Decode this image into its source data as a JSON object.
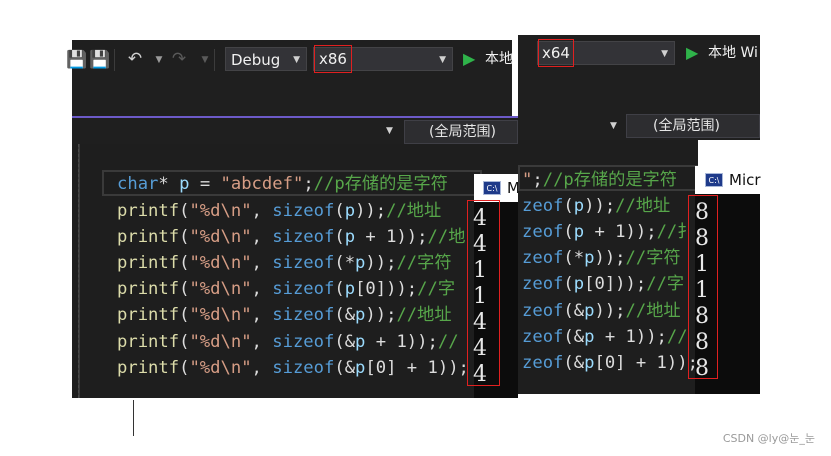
{
  "left_window": {
    "toolbar": {
      "undo_icon": "undo-icon",
      "redo_icon": "redo-icon",
      "save_icon": "save-icon",
      "save_all_icon": "save-all-icon",
      "configuration": "Debug",
      "platform": "x86",
      "run_label": "本地"
    },
    "scope_combo": "(全局范围)",
    "code_lines": [
      {
        "parts": [
          [
            "kw",
            "char"
          ],
          [
            "plain",
            "* "
          ],
          [
            "var",
            "p"
          ],
          [
            "plain",
            " = "
          ],
          [
            "str",
            "\"abcdef\""
          ],
          [
            "plain",
            ";"
          ],
          [
            "cmt",
            "//p存储的是字符"
          ]
        ]
      },
      {
        "parts": [
          [
            "fn",
            "printf"
          ],
          [
            "plain",
            "("
          ],
          [
            "str",
            "\"%d\\n\""
          ],
          [
            "plain",
            ", "
          ],
          [
            "kw",
            "sizeof"
          ],
          [
            "plain",
            "("
          ],
          [
            "var",
            "p"
          ],
          [
            "plain",
            "));"
          ],
          [
            "cmt",
            "//地址"
          ]
        ]
      },
      {
        "parts": [
          [
            "fn",
            "printf"
          ],
          [
            "plain",
            "("
          ],
          [
            "str",
            "\"%d\\n\""
          ],
          [
            "plain",
            ", "
          ],
          [
            "kw",
            "sizeof"
          ],
          [
            "plain",
            "("
          ],
          [
            "var",
            "p"
          ],
          [
            "plain",
            " + 1));"
          ],
          [
            "cmt",
            "//地"
          ]
        ]
      },
      {
        "parts": [
          [
            "fn",
            "printf"
          ],
          [
            "plain",
            "("
          ],
          [
            "str",
            "\"%d\\n\""
          ],
          [
            "plain",
            ", "
          ],
          [
            "kw",
            "sizeof"
          ],
          [
            "plain",
            "(*"
          ],
          [
            "var",
            "p"
          ],
          [
            "plain",
            "));"
          ],
          [
            "cmt",
            "//字符"
          ]
        ]
      },
      {
        "parts": [
          [
            "fn",
            "printf"
          ],
          [
            "plain",
            "("
          ],
          [
            "str",
            "\"%d\\n\""
          ],
          [
            "plain",
            ", "
          ],
          [
            "kw",
            "sizeof"
          ],
          [
            "plain",
            "("
          ],
          [
            "var",
            "p"
          ],
          [
            "plain",
            "[0]));"
          ],
          [
            "cmt",
            "//字"
          ]
        ]
      },
      {
        "parts": [
          [
            "fn",
            "printf"
          ],
          [
            "plain",
            "("
          ],
          [
            "str",
            "\"%d\\n\""
          ],
          [
            "plain",
            ", "
          ],
          [
            "kw",
            "sizeof"
          ],
          [
            "plain",
            "(&"
          ],
          [
            "var",
            "p"
          ],
          [
            "plain",
            "));"
          ],
          [
            "cmt",
            "//地址"
          ]
        ]
      },
      {
        "parts": [
          [
            "fn",
            "printf"
          ],
          [
            "plain",
            "("
          ],
          [
            "str",
            "\"%d\\n\""
          ],
          [
            "plain",
            ", "
          ],
          [
            "kw",
            "sizeof"
          ],
          [
            "plain",
            "(&"
          ],
          [
            "var",
            "p"
          ],
          [
            "plain",
            " + 1));"
          ],
          [
            "cmt",
            "//"
          ]
        ]
      },
      {
        "parts": [
          [
            "fn",
            "printf"
          ],
          [
            "plain",
            "("
          ],
          [
            "str",
            "\"%d\\n\""
          ],
          [
            "plain",
            ", "
          ],
          [
            "kw",
            "sizeof"
          ],
          [
            "plain",
            "(&"
          ],
          [
            "var",
            "p"
          ],
          [
            "plain",
            "[0] + 1));"
          ]
        ]
      }
    ],
    "console": {
      "title": "Mic",
      "icon": "C:\\",
      "outputs": [
        "4",
        "4",
        "1",
        "1",
        "4",
        "4",
        "4"
      ]
    }
  },
  "right_window": {
    "toolbar": {
      "platform": "x64",
      "run_label": "本地 Wi"
    },
    "scope_combo": "(全局范围)",
    "code_lines": [
      {
        "parts": [
          [
            "str",
            "\""
          ],
          [
            "plain",
            ";"
          ],
          [
            "cmt",
            "//p存储的是字符"
          ]
        ]
      },
      {
        "parts": [
          [
            "kw",
            "zeof"
          ],
          [
            "plain",
            "("
          ],
          [
            "var",
            "p"
          ],
          [
            "plain",
            "));"
          ],
          [
            "cmt",
            "//地址"
          ]
        ]
      },
      {
        "parts": [
          [
            "kw",
            "zeof"
          ],
          [
            "plain",
            "("
          ],
          [
            "var",
            "p"
          ],
          [
            "plain",
            " + 1));"
          ],
          [
            "cmt",
            "//扌"
          ]
        ]
      },
      {
        "parts": [
          [
            "kw",
            "zeof"
          ],
          [
            "plain",
            "(*"
          ],
          [
            "var",
            "p"
          ],
          [
            "plain",
            "));"
          ],
          [
            "cmt",
            "//字符"
          ]
        ]
      },
      {
        "parts": [
          [
            "kw",
            "zeof"
          ],
          [
            "plain",
            "("
          ],
          [
            "var",
            "p"
          ],
          [
            "plain",
            "[0]));"
          ],
          [
            "cmt",
            "//字"
          ]
        ]
      },
      {
        "parts": [
          [
            "kw",
            "zeof"
          ],
          [
            "plain",
            "(&"
          ],
          [
            "var",
            "p"
          ],
          [
            "plain",
            "));"
          ],
          [
            "cmt",
            "//地址"
          ]
        ]
      },
      {
        "parts": [
          [
            "kw",
            "zeof"
          ],
          [
            "plain",
            "(&"
          ],
          [
            "var",
            "p"
          ],
          [
            "plain",
            " + 1));"
          ],
          [
            "cmt",
            "//"
          ]
        ]
      },
      {
        "parts": [
          [
            "kw",
            "zeof"
          ],
          [
            "plain",
            "(&"
          ],
          [
            "var",
            "p"
          ],
          [
            "plain",
            "[0] + 1));"
          ]
        ]
      }
    ],
    "console": {
      "title": "Micr",
      "icon": "C:\\",
      "outputs": [
        "8",
        "8",
        "1",
        "1",
        "8",
        "8",
        "8"
      ]
    }
  },
  "watermark": "CSDN @ly@눈_눈"
}
